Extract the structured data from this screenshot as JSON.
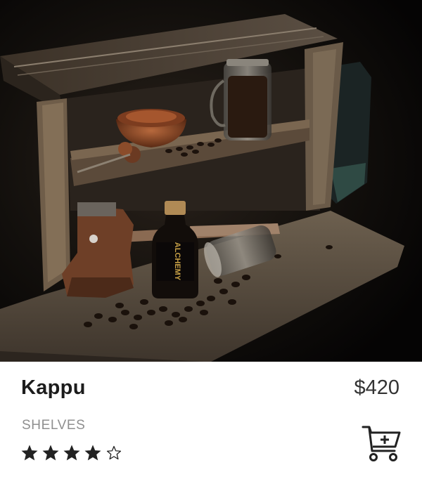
{
  "product": {
    "name": "Kappu",
    "price": "$420",
    "category": "SHELVES",
    "rating": 4,
    "rating_max": 5
  },
  "image": {
    "bottle_label": "ALCHEMY"
  },
  "icons": {
    "star_filled": "star-filled-icon",
    "star_empty": "star-outline-icon",
    "cart": "add-to-cart-icon"
  },
  "colors": {
    "text_primary": "#1c1c1c",
    "text_secondary": "#8f8f8f",
    "price": "#333333",
    "icon": "#222222"
  }
}
